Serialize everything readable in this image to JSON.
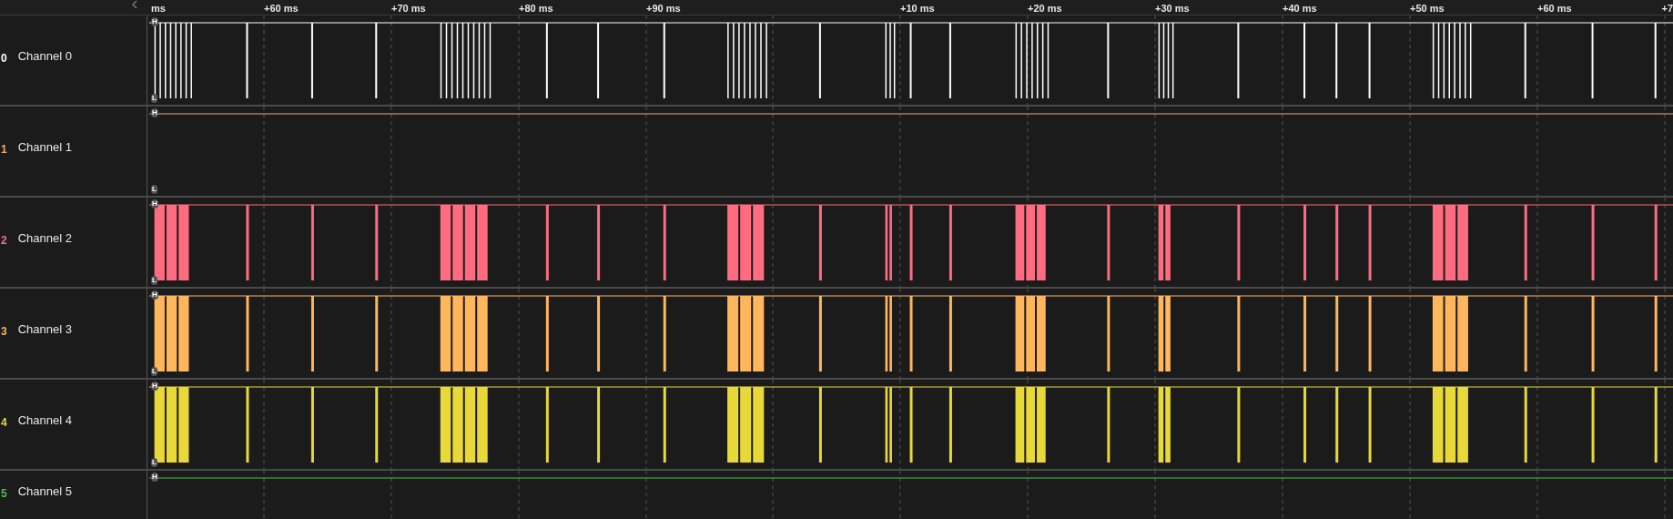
{
  "timeline": {
    "ticks": [
      "ms",
      "+60 ms",
      "+70 ms",
      "+80 ms",
      "+90 ms",
      "+10 ms",
      "+20 ms",
      "+30 ms",
      "+40 ms",
      "+50 ms",
      "+60 ms",
      "+7"
    ]
  },
  "channels": [
    {
      "number": "0",
      "name": "Channel 0",
      "color": "#ffffff",
      "kind": "pulses",
      "high_label": "H",
      "low_label": "L"
    },
    {
      "number": "1",
      "name": "Channel 1",
      "color": "#f2a77a",
      "kind": "flat",
      "high_label": "H",
      "low_label": "L"
    },
    {
      "number": "2",
      "name": "Channel 2",
      "color": "#ff6b7f",
      "kind": "blocks",
      "high_label": "H",
      "low_label": "L"
    },
    {
      "number": "3",
      "name": "Channel 3",
      "color": "#ffb65c",
      "kind": "blocks",
      "high_label": "H",
      "low_label": "L"
    },
    {
      "number": "4",
      "name": "Channel 4",
      "color": "#e8d838",
      "kind": "blocks",
      "high_label": "H",
      "low_label": "L"
    },
    {
      "number": "5",
      "name": "Channel 5",
      "color": "#4cc24c",
      "kind": "flat",
      "high_label": "H"
    }
  ]
}
